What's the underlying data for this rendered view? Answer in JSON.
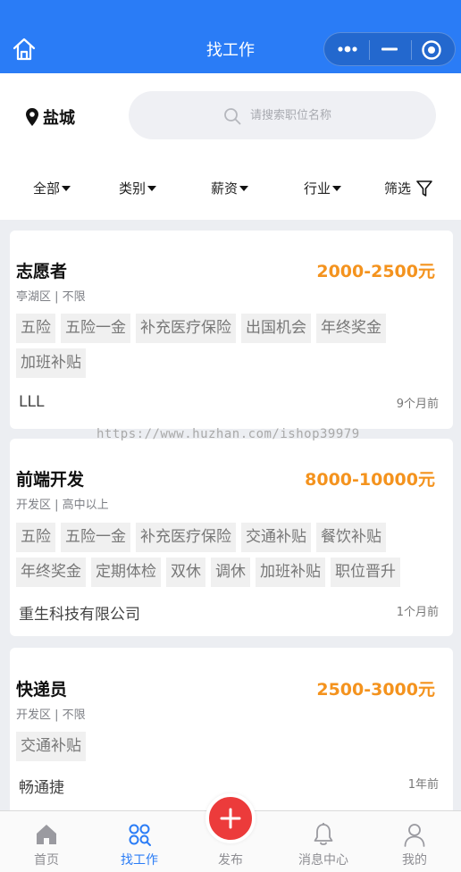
{
  "navbar": {
    "title": "找工作"
  },
  "header": {
    "city": "盐城",
    "search_placeholder": "请搜索职位名称"
  },
  "filters": {
    "all": "全部",
    "category": "类别",
    "salary": "薪资",
    "industry": "行业",
    "filter": "筛选"
  },
  "jobs": [
    {
      "title": "志愿者",
      "salary": "2000-2500元",
      "meta": "亭湖区 | 不限",
      "tags": [
        "五险",
        "五险一金",
        "补充医疗保险",
        "出国机会",
        "年终奖金",
        "加班补贴"
      ],
      "company": "LLL",
      "time": "9个月前"
    },
    {
      "title": "前端开发",
      "salary": "8000-10000元",
      "meta": "开发区 | 高中以上",
      "tags": [
        "五险",
        "五险一金",
        "补充医疗保险",
        "交通补贴",
        "餐饮补贴",
        "年终奖金",
        "定期体检",
        "双休",
        "调休",
        "加班补贴",
        "职位晋升"
      ],
      "company": "重生科技有限公司",
      "time": "1个月前"
    },
    {
      "title": "快递员",
      "salary": "2500-3000元",
      "meta": "开发区 | 不限",
      "tags": [
        "交通补贴"
      ],
      "company": "畅通捷",
      "time": "1年前"
    }
  ],
  "watermark": "https://www.huzhan.com/ishop39979",
  "tabbar": {
    "home": "首页",
    "jobs": "找工作",
    "publish": "发布",
    "messages": "消息中心",
    "mine": "我的"
  },
  "colors": {
    "primary": "#2a7cf6",
    "salary": "#f4931e",
    "publish": "#ec3b3b"
  }
}
